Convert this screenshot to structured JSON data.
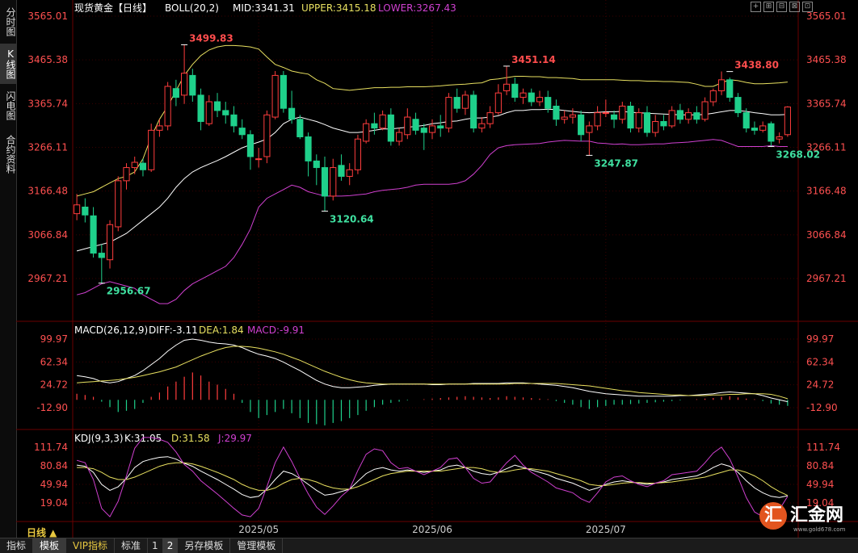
{
  "side_tabs": [
    "分时图",
    "K线图",
    "闪电图",
    "合约资料"
  ],
  "side_tab_active": 1,
  "bottom_tabs": [
    {
      "label": "指标"
    },
    {
      "label": "模板",
      "active": true
    },
    {
      "label": "VIP指标",
      "vip": true
    },
    {
      "label": "标准"
    },
    {
      "label": "1",
      "num": true
    },
    {
      "label": "2",
      "num": true,
      "active": true
    },
    {
      "label": "另存模板"
    },
    {
      "label": "管理模板"
    }
  ],
  "period_label": "日线 ▲",
  "logo": {
    "circle": "汇",
    "text": "汇金网",
    "url": "www.gold678.com"
  },
  "window_controls": [
    "+",
    "⊞",
    "⊟",
    "⊠",
    "⊡"
  ],
  "colors": {
    "up": "#ff3d3d",
    "down": "#1fd08b",
    "ma": "#ffffff",
    "upper": "#e8e060",
    "lower": "#d040d0",
    "grid": "#3a0000",
    "axis_text": "#ff5050",
    "macd_dea": "#e8e060",
    "macd_diff": "#ffffff",
    "kdj_k": "#ffffff",
    "kdj_d": "#e8e060",
    "kdj_j": "#d040d0"
  },
  "chart_data": {
    "type": "candlestick",
    "instrument": "现货黄金【日线】",
    "boll_header": {
      "name": "BOLL(20,2)",
      "mid": "MID:3341.31",
      "upper": "UPPER:3415.18",
      "lower": "LOWER:3267.43"
    },
    "macd_header": {
      "name": "MACD(26,12,9)",
      "diff": "DIFF:-3.11",
      "dea": "DEA:1.84",
      "macd": "MACD:-9.91"
    },
    "kdj_header": {
      "name": "KDJ(9,3,3)",
      "k": "K:31.05",
      "d": "D:31.58",
      "j": "J:29.97"
    },
    "price_ticks": [
      "3565.01",
      "3465.38",
      "3365.74",
      "3266.11",
      "3166.48",
      "3066.84",
      "2967.21"
    ],
    "price_tick_values": [
      3565.01,
      3465.38,
      3365.74,
      3266.11,
      3166.48,
      3066.84,
      2967.21
    ],
    "macd_ticks": [
      "99.97",
      "62.34",
      "24.72",
      "-12.90"
    ],
    "macd_tick_values": [
      99.97,
      62.34,
      24.72,
      -12.9
    ],
    "kdj_ticks": [
      "111.74",
      "80.84",
      "49.94",
      "19.04"
    ],
    "kdj_tick_values": [
      111.74,
      80.84,
      49.94,
      19.04
    ],
    "x_labels": [
      {
        "label": "2025/05",
        "index": 22
      },
      {
        "label": "2025/06",
        "index": 43
      },
      {
        "label": "2025/07",
        "index": 64
      }
    ],
    "annotations": [
      {
        "label": "3499.83",
        "index": 13,
        "value": 3499.83,
        "kind": "high"
      },
      {
        "label": "3451.14",
        "index": 52,
        "value": 3451.14,
        "kind": "high"
      },
      {
        "label": "3438.80",
        "index": 79,
        "value": 3438.8,
        "kind": "high"
      },
      {
        "label": "2956.67",
        "index": 3,
        "value": 2956.67,
        "kind": "low"
      },
      {
        "label": "3120.64",
        "index": 30,
        "value": 3120.64,
        "kind": "low"
      },
      {
        "label": "3247.87",
        "index": 62,
        "value": 3247.87,
        "kind": "low"
      },
      {
        "label": "3268.02",
        "index": 84,
        "value": 3268.02,
        "kind": "low"
      }
    ],
    "candles": [
      [
        3115,
        3135,
        3160,
        3100
      ],
      [
        3130,
        3112,
        3150,
        3095
      ],
      [
        3110,
        3025,
        3130,
        3015
      ],
      [
        3025,
        3015,
        3045,
        2957
      ],
      [
        3010,
        3090,
        3100,
        2990
      ],
      [
        3085,
        3190,
        3200,
        3075
      ],
      [
        3190,
        3220,
        3230,
        3170
      ],
      [
        3220,
        3232,
        3245,
        3205
      ],
      [
        3230,
        3215,
        3240,
        3200
      ],
      [
        3215,
        3305,
        3320,
        3210
      ],
      [
        3305,
        3315,
        3330,
        3290
      ],
      [
        3315,
        3405,
        3415,
        3305
      ],
      [
        3400,
        3380,
        3420,
        3360
      ],
      [
        3385,
        3435,
        3500,
        3365
      ],
      [
        3430,
        3385,
        3445,
        3370
      ],
      [
        3385,
        3325,
        3400,
        3305
      ],
      [
        3320,
        3370,
        3385,
        3315
      ],
      [
        3370,
        3350,
        3390,
        3335
      ],
      [
        3350,
        3340,
        3370,
        3320
      ],
      [
        3340,
        3315,
        3360,
        3300
      ],
      [
        3310,
        3295,
        3330,
        3285
      ],
      [
        3295,
        3245,
        3305,
        3215
      ],
      [
        3240,
        3240,
        3265,
        3220
      ],
      [
        3245,
        3340,
        3350,
        3230
      ],
      [
        3335,
        3430,
        3440,
        3330
      ],
      [
        3430,
        3355,
        3440,
        3345
      ],
      [
        3355,
        3330,
        3395,
        3320
      ],
      [
        3330,
        3290,
        3340,
        3285
      ],
      [
        3290,
        3235,
        3300,
        3200
      ],
      [
        3235,
        3220,
        3250,
        3180
      ],
      [
        3220,
        3155,
        3245,
        3120
      ],
      [
        3155,
        3220,
        3240,
        3145
      ],
      [
        3225,
        3200,
        3250,
        3190
      ],
      [
        3200,
        3215,
        3230,
        3180
      ],
      [
        3215,
        3285,
        3295,
        3205
      ],
      [
        3280,
        3320,
        3330,
        3275
      ],
      [
        3320,
        3310,
        3345,
        3295
      ],
      [
        3310,
        3340,
        3350,
        3305
      ],
      [
        3340,
        3280,
        3355,
        3270
      ],
      [
        3280,
        3300,
        3310,
        3270
      ],
      [
        3295,
        3335,
        3355,
        3285
      ],
      [
        3330,
        3305,
        3345,
        3295
      ],
      [
        3310,
        3300,
        3320,
        3260
      ],
      [
        3300,
        3315,
        3330,
        3285
      ],
      [
        3315,
        3310,
        3340,
        3290
      ],
      [
        3310,
        3380,
        3390,
        3300
      ],
      [
        3380,
        3355,
        3400,
        3345
      ],
      [
        3355,
        3385,
        3395,
        3340
      ],
      [
        3385,
        3310,
        3395,
        3300
      ],
      [
        3310,
        3320,
        3335,
        3300
      ],
      [
        3320,
        3345,
        3360,
        3310
      ],
      [
        3345,
        3390,
        3410,
        3340
      ],
      [
        3395,
        3410,
        3451,
        3385
      ],
      [
        3410,
        3380,
        3425,
        3370
      ],
      [
        3380,
        3390,
        3400,
        3365
      ],
      [
        3390,
        3370,
        3400,
        3360
      ],
      [
        3370,
        3380,
        3395,
        3360
      ],
      [
        3380,
        3355,
        3395,
        3345
      ],
      [
        3360,
        3330,
        3375,
        3315
      ],
      [
        3330,
        3335,
        3350,
        3320
      ],
      [
        3335,
        3340,
        3355,
        3320
      ],
      [
        3340,
        3295,
        3350,
        3280
      ],
      [
        3300,
        3315,
        3325,
        3248
      ],
      [
        3315,
        3345,
        3360,
        3305
      ],
      [
        3345,
        3345,
        3375,
        3335
      ],
      [
        3340,
        3330,
        3350,
        3310
      ],
      [
        3330,
        3360,
        3370,
        3320
      ],
      [
        3360,
        3310,
        3370,
        3300
      ],
      [
        3310,
        3345,
        3355,
        3300
      ],
      [
        3345,
        3300,
        3360,
        3290
      ],
      [
        3300,
        3325,
        3340,
        3290
      ],
      [
        3325,
        3315,
        3340,
        3305
      ],
      [
        3315,
        3350,
        3360,
        3310
      ],
      [
        3350,
        3330,
        3365,
        3320
      ],
      [
        3330,
        3345,
        3355,
        3320
      ],
      [
        3345,
        3330,
        3360,
        3320
      ],
      [
        3330,
        3370,
        3380,
        3325
      ],
      [
        3370,
        3395,
        3400,
        3360
      ],
      [
        3395,
        3420,
        3439,
        3385
      ],
      [
        3420,
        3380,
        3425,
        3370
      ],
      [
        3380,
        3345,
        3390,
        3335
      ],
      [
        3345,
        3310,
        3355,
        3300
      ],
      [
        3310,
        3305,
        3325,
        3295
      ],
      [
        3305,
        3315,
        3325,
        3300
      ],
      [
        3320,
        3280,
        3325,
        3268
      ],
      [
        3285,
        3290,
        3300,
        3275
      ],
      [
        3295,
        3358,
        3360,
        3290
      ]
    ],
    "boll_mid": [
      3030,
      3035,
      3040,
      3045,
      3050,
      3060,
      3070,
      3085,
      3100,
      3115,
      3130,
      3150,
      3175,
      3195,
      3210,
      3220,
      3228,
      3236,
      3245,
      3255,
      3265,
      3272,
      3278,
      3285,
      3300,
      3320,
      3330,
      3335,
      3330,
      3325,
      3318,
      3310,
      3305,
      3300,
      3300,
      3302,
      3305,
      3308,
      3308,
      3310,
      3312,
      3314,
      3316,
      3320,
      3322,
      3325,
      3326,
      3330,
      3333,
      3333,
      3335,
      3338,
      3345,
      3350,
      3350,
      3352,
      3352,
      3353,
      3352,
      3350,
      3348,
      3346,
      3345,
      3346,
      3347,
      3347,
      3348,
      3346,
      3345,
      3344,
      3343,
      3342,
      3341,
      3340,
      3340,
      3340,
      3341,
      3344,
      3347,
      3350,
      3350,
      3348,
      3345,
      3343,
      3340,
      3340,
      3341
    ],
    "boll_upper": [
      3155,
      3160,
      3165,
      3175,
      3185,
      3195,
      3200,
      3210,
      3240,
      3290,
      3330,
      3360,
      3395,
      3430,
      3455,
      3475,
      3488,
      3495,
      3498,
      3498,
      3497,
      3495,
      3490,
      3472,
      3455,
      3448,
      3440,
      3436,
      3433,
      3420,
      3412,
      3400,
      3398,
      3396,
      3398,
      3400,
      3402,
      3402,
      3403,
      3403,
      3404,
      3404,
      3404,
      3405,
      3406,
      3408,
      3409,
      3410,
      3412,
      3413,
      3420,
      3422,
      3425,
      3428,
      3428,
      3427,
      3427,
      3425,
      3425,
      3424,
      3423,
      3420,
      3420,
      3420,
      3420,
      3420,
      3419,
      3418,
      3418,
      3417,
      3417,
      3416,
      3416,
      3415,
      3414,
      3410,
      3405,
      3405,
      3413,
      3420,
      3418,
      3414,
      3411,
      3411,
      3412,
      3413,
      3415
    ],
    "boll_lower": [
      2930,
      2935,
      2945,
      2955,
      2960,
      2955,
      2950,
      2945,
      2930,
      2920,
      2910,
      2910,
      2920,
      2940,
      2955,
      2965,
      2975,
      2985,
      2995,
      3015,
      3045,
      3080,
      3130,
      3150,
      3160,
      3170,
      3180,
      3175,
      3165,
      3160,
      3155,
      3155,
      3155,
      3156,
      3158,
      3160,
      3165,
      3168,
      3170,
      3172,
      3175,
      3180,
      3182,
      3182,
      3182,
      3182,
      3184,
      3190,
      3205,
      3225,
      3250,
      3265,
      3270,
      3272,
      3273,
      3274,
      3275,
      3278,
      3280,
      3282,
      3281,
      3280,
      3280,
      3276,
      3275,
      3273,
      3274,
      3272,
      3272,
      3273,
      3274,
      3274,
      3276,
      3277,
      3278,
      3280,
      3282,
      3284,
      3282,
      3275,
      3268,
      3268,
      3268,
      3268,
      3270,
      3268,
      3268
    ],
    "macd_hist": [
      10,
      8,
      5,
      -3,
      -12,
      -20,
      -18,
      -15,
      -5,
      5,
      12,
      22,
      30,
      38,
      45,
      40,
      30,
      25,
      18,
      10,
      -5,
      -20,
      -30,
      -25,
      -20,
      -15,
      -22,
      -30,
      -38,
      -40,
      -42,
      -38,
      -35,
      -30,
      -25,
      -18,
      -12,
      -8,
      -5,
      -3,
      -1,
      0,
      1,
      2,
      3,
      4,
      5,
      6,
      5,
      4,
      3,
      4,
      6,
      5,
      4,
      3,
      2,
      1,
      -2,
      -5,
      -8,
      -12,
      -15,
      -12,
      -10,
      -8,
      -8,
      -7,
      -6,
      -5,
      -4,
      -3,
      -2,
      -1,
      0,
      1,
      2,
      3,
      5,
      6,
      4,
      2,
      1,
      -2,
      -6,
      -8,
      -9.91
    ],
    "macd_diff": [
      40,
      38,
      35,
      30,
      28,
      30,
      35,
      40,
      48,
      58,
      68,
      80,
      90,
      98,
      100,
      98,
      95,
      93,
      92,
      90,
      86,
      80,
      75,
      72,
      68,
      62,
      55,
      48,
      40,
      32,
      26,
      22,
      20,
      20,
      21,
      22,
      24,
      25,
      26,
      26,
      26,
      26,
      26,
      25,
      25,
      26,
      26,
      26,
      27,
      27,
      27,
      27,
      28,
      28,
      28,
      27,
      26,
      25,
      24,
      22,
      20,
      17,
      14,
      12,
      10,
      9,
      8,
      7,
      6,
      6,
      6,
      6,
      6,
      7,
      7,
      8,
      9,
      10,
      12,
      13,
      12,
      11,
      10,
      7,
      3,
      0,
      -3.11
    ],
    "macd_dea": [
      28,
      29,
      30,
      31,
      32,
      33,
      35,
      37,
      40,
      43,
      46,
      50,
      54,
      60,
      66,
      72,
      77,
      82,
      86,
      88,
      88,
      87,
      85,
      82,
      79,
      75,
      70,
      65,
      59,
      53,
      47,
      42,
      37,
      33,
      30,
      28,
      27,
      26,
      26,
      26,
      26,
      26,
      26,
      26,
      26,
      26,
      26,
      26,
      26,
      26,
      26,
      26,
      26,
      27,
      27,
      27,
      27,
      27,
      27,
      26,
      25,
      24,
      23,
      21,
      19,
      17,
      15,
      14,
      12,
      11,
      10,
      9,
      8,
      8,
      7,
      7,
      7,
      8,
      8,
      9,
      9,
      10,
      10,
      10,
      9,
      6,
      1.84
    ],
    "kdj_k": [
      82,
      80,
      70,
      50,
      40,
      46,
      60,
      78,
      88,
      92,
      95,
      96,
      92,
      85,
      80,
      72,
      65,
      58,
      50,
      42,
      33,
      28,
      30,
      42,
      58,
      72,
      68,
      60,
      50,
      40,
      32,
      34,
      38,
      42,
      55,
      68,
      75,
      78,
      74,
      72,
      74,
      72,
      70,
      72,
      74,
      80,
      82,
      78,
      72,
      68,
      66,
      70,
      76,
      82,
      78,
      74,
      70,
      66,
      60,
      56,
      52,
      46,
      40,
      44,
      50,
      54,
      56,
      54,
      52,
      50,
      52,
      54,
      58,
      60,
      62,
      64,
      70,
      78,
      84,
      80,
      70,
      56,
      44,
      36,
      30,
      28,
      31.05
    ],
    "kdj_d": [
      78,
      78,
      76,
      70,
      62,
      58,
      58,
      62,
      68,
      74,
      80,
      84,
      86,
      86,
      84,
      80,
      75,
      70,
      64,
      58,
      50,
      44,
      40,
      40,
      44,
      52,
      58,
      60,
      58,
      54,
      48,
      44,
      42,
      42,
      46,
      52,
      58,
      64,
      68,
      70,
      72,
      72,
      72,
      72,
      72,
      74,
      76,
      78,
      78,
      76,
      72,
      70,
      71,
      74,
      76,
      76,
      74,
      72,
      68,
      64,
      60,
      56,
      50,
      48,
      48,
      50,
      52,
      53,
      53,
      52,
      52,
      53,
      54,
      56,
      58,
      60,
      62,
      66,
      70,
      74,
      74,
      70,
      64,
      56,
      46,
      38,
      31.58
    ],
    "kdj_j": [
      90,
      86,
      58,
      10,
      -4,
      22,
      64,
      110,
      128,
      128,
      125,
      120,
      104,
      83,
      72,
      56,
      45,
      34,
      22,
      10,
      -1,
      -4,
      10,
      46,
      86,
      112,
      88,
      60,
      34,
      12,
      0,
      14,
      30,
      42,
      73,
      100,
      109,
      106,
      86,
      76,
      78,
      72,
      66,
      72,
      78,
      92,
      94,
      78,
      60,
      52,
      54,
      70,
      86,
      98,
      82,
      70,
      62,
      54,
      44,
      40,
      36,
      26,
      20,
      36,
      54,
      62,
      64,
      56,
      50,
      46,
      52,
      56,
      66,
      68,
      70,
      72,
      86,
      102,
      112,
      92,
      62,
      28,
      4,
      -4,
      -2,
      8,
      29.97
    ]
  }
}
